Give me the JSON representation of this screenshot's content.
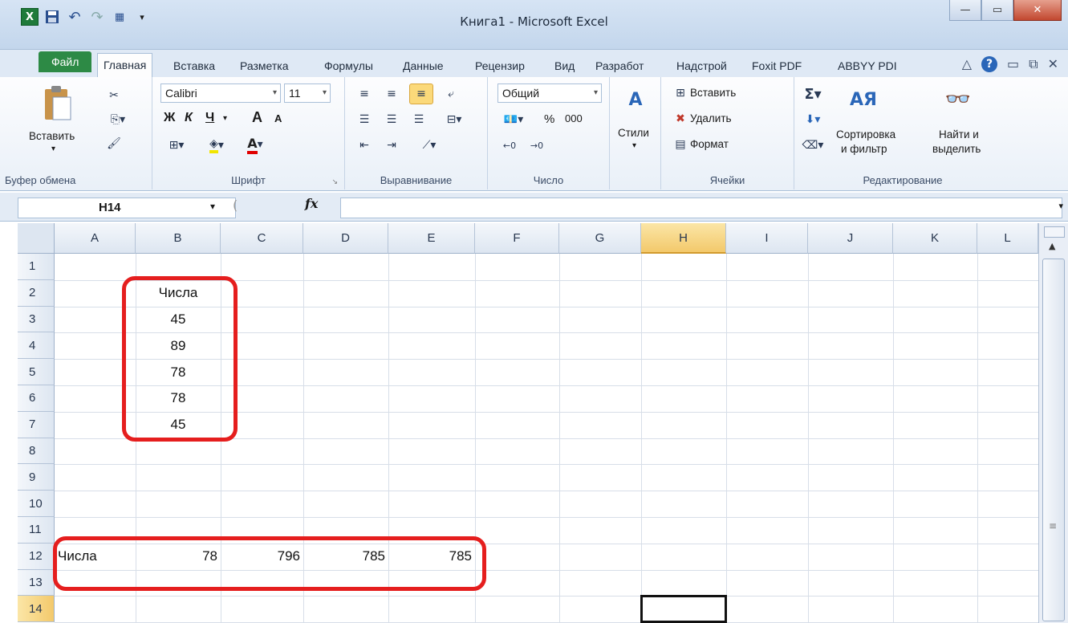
{
  "window": {
    "title": "Книга1  -  Microsoft Excel",
    "qat": {
      "logo": "X",
      "save_icon": "floppy-icon",
      "undo_icon": "undo-icon",
      "redo_icon": "redo-icon"
    }
  },
  "tabs": [
    "Файл",
    "Главная",
    "Вставка",
    "Разметка",
    "Формулы",
    "Данные",
    "Рецензир",
    "Вид",
    "Разработ",
    "Надстрой",
    "Foxit PDF",
    "ABBYY PDI"
  ],
  "active_tab": "Главная",
  "ribbon": {
    "clipboard": {
      "paste": "Вставить",
      "label": "Буфер обмена"
    },
    "font": {
      "name": "Calibri",
      "size": "11",
      "bold": "Ж",
      "italic": "К",
      "underline": "Ч",
      "grow": "A",
      "shrink": "A",
      "label": "Шрифт"
    },
    "alignment": {
      "label": "Выравнивание"
    },
    "number": {
      "format": "Общий",
      "percent": "%",
      "thousands": "000",
      "label": "Число"
    },
    "styles": {
      "label": "Стили"
    },
    "cells": {
      "insert": "Вставить",
      "delete": "Удалить",
      "format": "Формат",
      "label": "Ячейки"
    },
    "editing": {
      "sort": "Сортировка",
      "sort2": "и фильтр",
      "find": "Найти и",
      "find2": "выделить",
      "label": "Редактирование"
    }
  },
  "formula_bar": {
    "name_box": "H14",
    "fx": "fx",
    "formula": ""
  },
  "columns": [
    "A",
    "B",
    "C",
    "D",
    "E",
    "F",
    "G",
    "H",
    "I",
    "J",
    "K",
    "L"
  ],
  "rows": [
    "1",
    "2",
    "3",
    "4",
    "5",
    "6",
    "7",
    "8",
    "9",
    "10",
    "11",
    "12",
    "13",
    "14"
  ],
  "selected": {
    "column": "H",
    "row": "14"
  },
  "cells": {
    "B2": "Числа",
    "B3": "45",
    "B4": "89",
    "B5": "78",
    "B6": "78",
    "B7": "45",
    "A12": "Числа",
    "B12": "78",
    "C12": "796",
    "D12": "785",
    "E12": "785"
  },
  "accent_colors": {
    "highlight": "#e51e1e",
    "file_tab": "#2d8a45",
    "selected_header": "#f3c96b"
  }
}
